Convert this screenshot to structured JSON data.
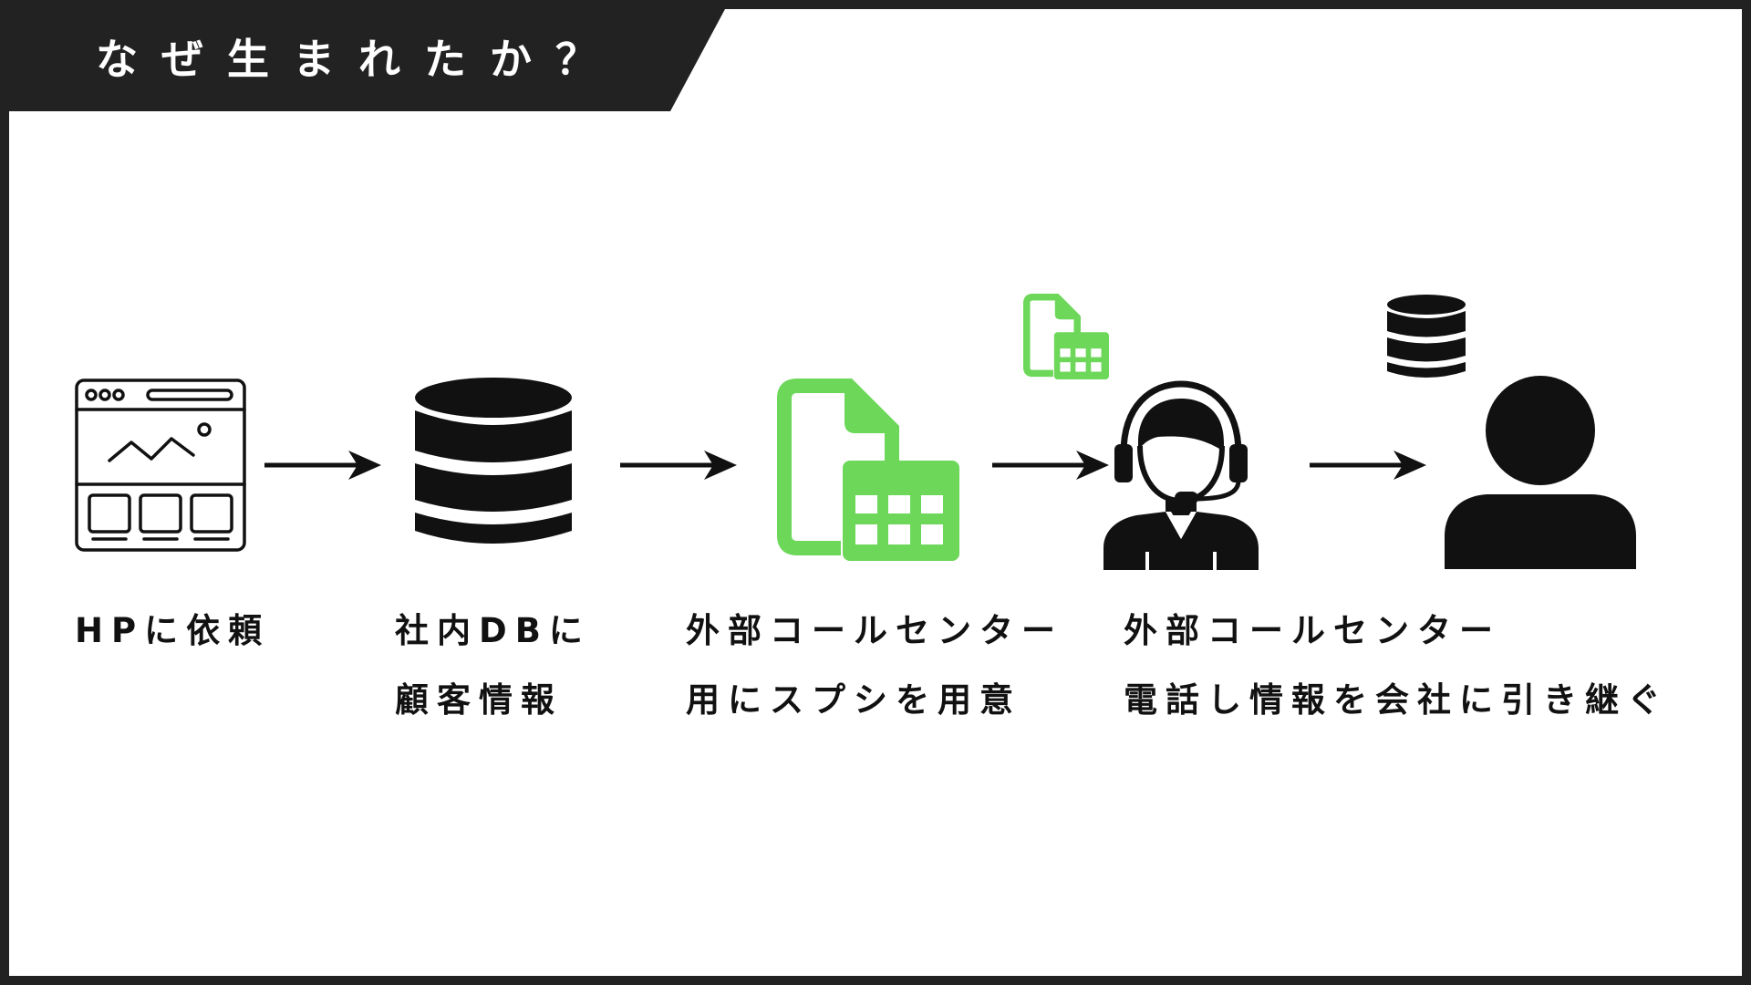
{
  "header": {
    "title": "なぜ生まれたか？"
  },
  "colors": {
    "accent_green": "#6dd75a",
    "dark": "#222222",
    "black": "#000000",
    "background": "#ffffff"
  },
  "flow": {
    "step1": {
      "icon": "web-page-icon",
      "lines": [
        "HPに依頼"
      ]
    },
    "step2": {
      "icon": "database-icon",
      "lines": [
        "社内DBに",
        "顧客情報"
      ]
    },
    "step3": {
      "icon": "spreadsheet-file-icon",
      "lines": [
        "外部コールセンター",
        "用にスプシを用意"
      ]
    },
    "step4": {
      "icon": "call-center-operator-icon",
      "lines": [
        "外部コールセンター",
        "電話し情報を会社に引き継ぐ"
      ]
    },
    "step5": {
      "icon": "person-icon",
      "lines": []
    }
  }
}
